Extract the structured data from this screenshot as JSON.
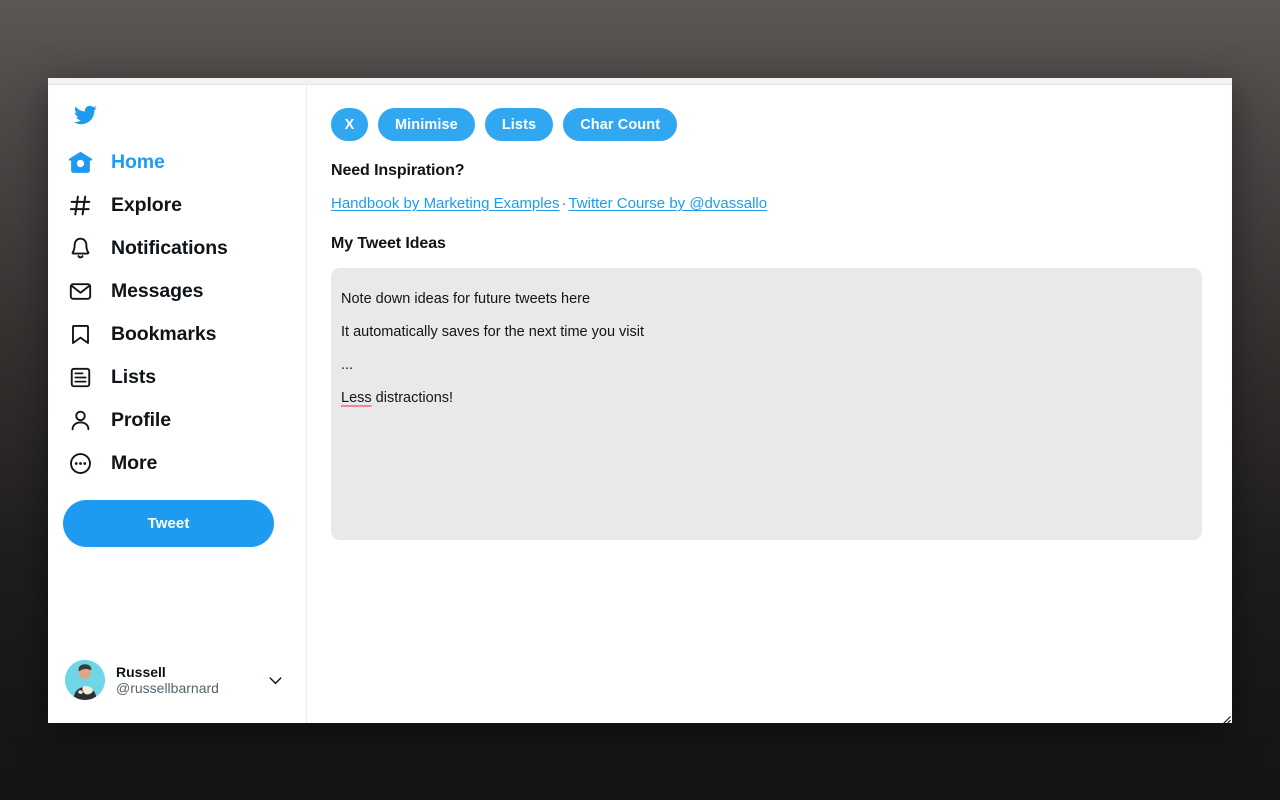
{
  "window": {
    "resize_grip": "resize-grip"
  },
  "sidebar": {
    "logo": "twitter-bird-icon",
    "items": [
      {
        "label": "Home",
        "icon": "home-icon",
        "active": true
      },
      {
        "label": "Explore",
        "icon": "hashtag-icon",
        "active": false
      },
      {
        "label": "Notifications",
        "icon": "bell-icon",
        "active": false
      },
      {
        "label": "Messages",
        "icon": "envelope-icon",
        "active": false
      },
      {
        "label": "Bookmarks",
        "icon": "bookmark-icon",
        "active": false
      },
      {
        "label": "Lists",
        "icon": "list-icon",
        "active": false
      },
      {
        "label": "Profile",
        "icon": "person-icon",
        "active": false
      },
      {
        "label": "More",
        "icon": "more-circle-icon",
        "active": false
      }
    ],
    "tweet_button_label": "Tweet",
    "account": {
      "display_name": "Russell",
      "handle": "@russellbarnard",
      "chevron": "chevron-down-icon"
    }
  },
  "main": {
    "toolbar": {
      "close_label": "X",
      "minimise_label": "Minimise",
      "lists_label": "Lists",
      "char_count_label": "Char Count"
    },
    "inspiration": {
      "heading": "Need Inspiration?",
      "link_one": "Handbook by Marketing Examples",
      "separator": "·",
      "link_two": "Twitter Course by @dvassallo"
    },
    "ideas": {
      "heading": "My Tweet Ideas",
      "line_one": "Note down ideas for future tweets here",
      "line_two": "It automatically saves for the next time you visit",
      "line_three": "...",
      "line_four_misspelled": "Less",
      "line_four_rest": " distractions!"
    }
  },
  "colors": {
    "twitter_blue": "#1d9bf0",
    "pill_blue": "#32a7f1",
    "textarea_bg": "#e9e9e9",
    "spellcheck_underline": "#f4869c",
    "text_primary": "#0f1419",
    "text_secondary": "#536471"
  }
}
